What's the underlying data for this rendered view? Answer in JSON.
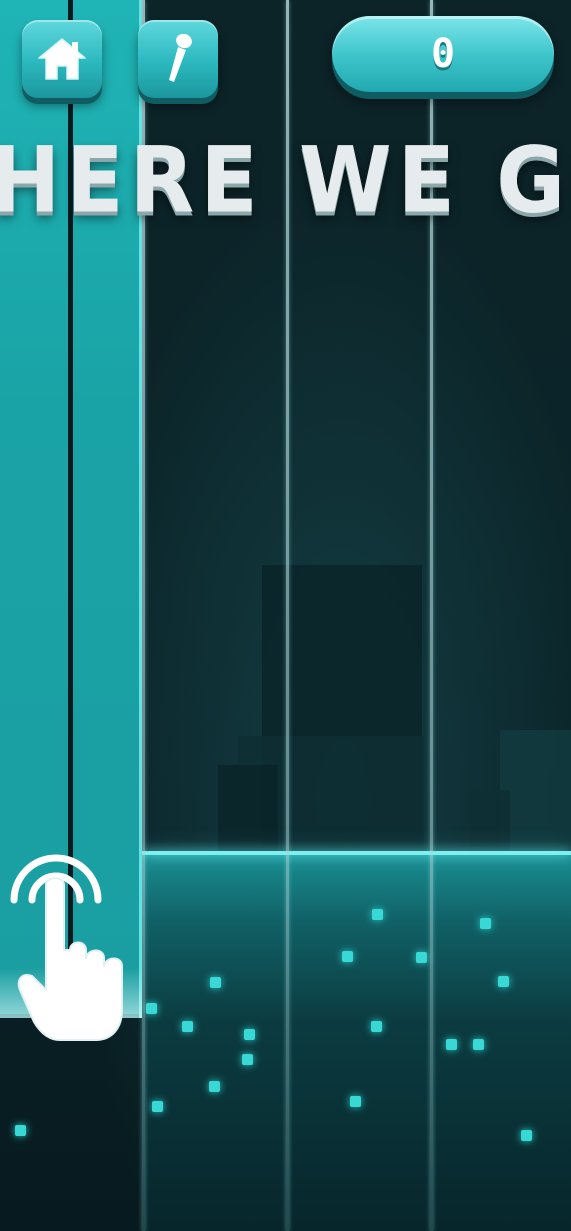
{
  "hud": {
    "home_icon": "home-icon",
    "mic_icon": "microphone-icon",
    "score": "0"
  },
  "banner": {
    "text": "HERE WE GO"
  },
  "hint": {
    "icon": "tap-hand-icon"
  },
  "colors": {
    "tile": "#1aa3a6",
    "accent": "#5ee8e8",
    "button": "#2bb8be",
    "background": "#071a1f"
  }
}
